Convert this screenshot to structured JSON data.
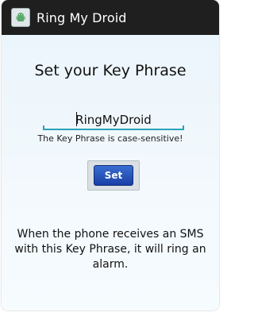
{
  "titlebar": {
    "title": "Ring My Droid",
    "icon": "android-droid-icon"
  },
  "main": {
    "heading": "Set your Key Phrase",
    "key_phrase": {
      "value": "RingMyDroid",
      "placeholder": ""
    },
    "hint": "The Key Phrase is case-sensitive!",
    "set_label": "Set",
    "description": "When the phone receives an SMS with this Key Phrase, it will ring an alarm."
  },
  "colors": {
    "accent": "#2aa3b8",
    "button": "#1a3fa6",
    "titlebar": "#1f1f1f"
  }
}
